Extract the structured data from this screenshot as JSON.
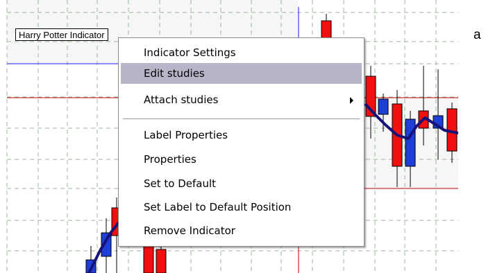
{
  "chart": {
    "indicator_label": "Harry Potter Indicator",
    "margin_letter": "a",
    "colors": {
      "up_candle": "#1e3fd6",
      "down_candle": "#f01010",
      "indicator_line": "#16127a",
      "grid": "#9bb59b",
      "blue_line": "#1a1aff",
      "red_line": "#c00000"
    }
  },
  "context_menu": {
    "items": [
      {
        "label": "Indicator Settings"
      },
      {
        "label": "Edit studies",
        "highlighted": true
      },
      {
        "label": "Attach studies",
        "submenu": true
      },
      {
        "label": "Label Properties"
      },
      {
        "label": "Properties"
      },
      {
        "label": "Set to Default"
      },
      {
        "label": "Set Label to Default Position"
      },
      {
        "label": "Remove Indicator"
      }
    ]
  }
}
